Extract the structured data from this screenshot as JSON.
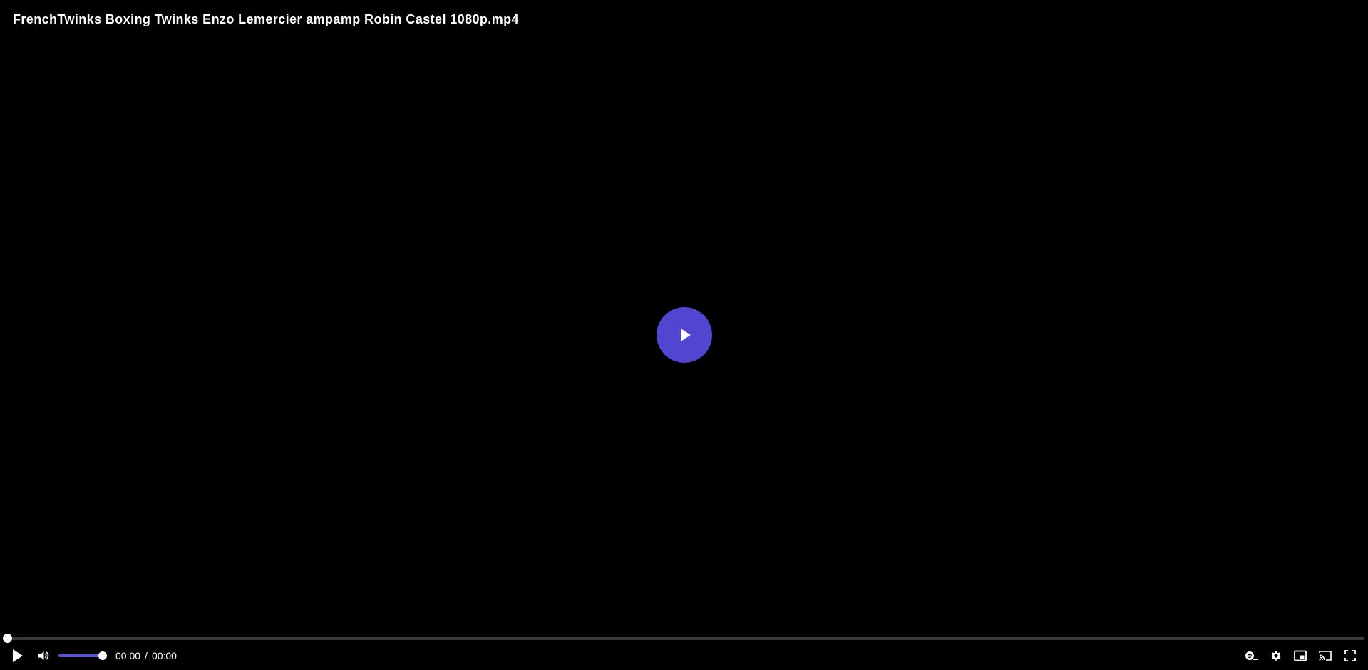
{
  "video": {
    "title": "FrenchTwinks Boxing Twinks Enzo Lemercier ampamp Robin Castel 1080p.mp4"
  },
  "playback": {
    "current_time": "00:00",
    "separator": "/",
    "duration": "00:00",
    "progress_fraction": 0,
    "volume_fraction": 1
  },
  "icons": {
    "big_play": "play-icon",
    "play": "play-icon",
    "volume": "volume-icon",
    "subtitles": "subtitles-icon",
    "settings": "gear-icon",
    "pip": "picture-in-picture-icon",
    "cast": "cast-icon",
    "fullscreen": "fullscreen-icon"
  },
  "colors": {
    "background": "#000000",
    "accent": "#5145d1",
    "accent_slider": "#5b4fe0",
    "track": "#3a3a3a",
    "text": "#ffffff"
  }
}
